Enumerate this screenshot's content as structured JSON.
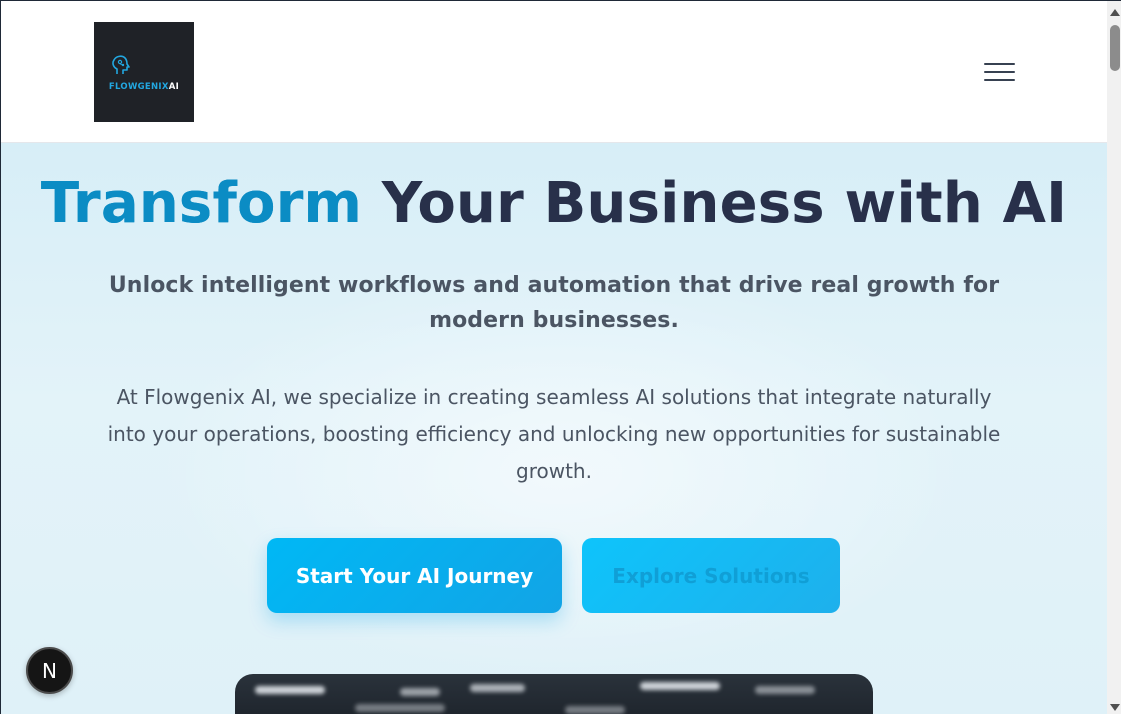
{
  "header": {
    "logo": {
      "brand": "FLOWGENIX",
      "suffix": "AI"
    },
    "menu_icon": "hamburger-menu-icon"
  },
  "hero": {
    "title_accent": "Transform",
    "title_rest": " Your Business with AI",
    "subtitle": "Unlock intelligent workflows and automation that drive real growth for modern businesses.",
    "body": "At Flowgenix AI, we specialize in creating seamless AI solutions that integrate naturally into your operations, boosting efficiency and unlocking new opportunities for sustainable growth.",
    "primary_cta": "Start Your AI Journey",
    "secondary_cta": "Explore Solutions"
  },
  "devtools": {
    "badge_label": "N"
  },
  "colors": {
    "accent": "#0b8cc4",
    "button": "#00b8f5",
    "heading": "#28304a",
    "hero_bg": "#dff1f8"
  }
}
